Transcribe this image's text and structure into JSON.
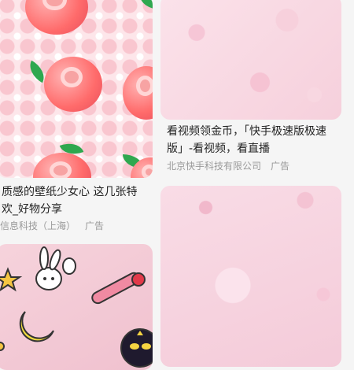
{
  "feed": {
    "cards": [
      {
        "id": "apple-wallpaper",
        "title_line1": "质感的壁纸少女心 这几张特",
        "title_line2": "欢_好物分享",
        "advertiser": "信息科技（上海）",
        "ad_label": "广告"
      },
      {
        "id": "kuaishou",
        "title_line1": "看视频领金币，「快手极速版极速",
        "title_line2": "版」-看视频，看直播",
        "advertiser": "北京快手科技有限公司",
        "ad_label": "广告"
      }
    ]
  },
  "colors": {
    "title": "#222222",
    "subtext": "#999999",
    "background": "#f5f5f5",
    "accent_pink": "#f6c6d6"
  }
}
